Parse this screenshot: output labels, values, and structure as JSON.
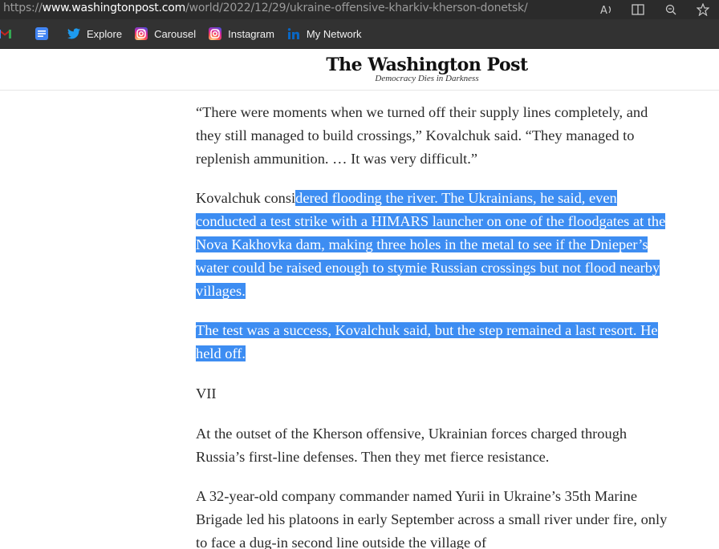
{
  "browser": {
    "url_prefix": "https://",
    "url_host": "www.washingtonpost.com",
    "url_path": "/world/2022/12/29/ukraine-offensive-kharkiv-kherson-donetsk/",
    "icons": [
      "read-aloud-icon",
      "split-screen-icon",
      "zoom-icon",
      "favorite-star-icon"
    ]
  },
  "bookmarks": [
    {
      "icon": "gmail-icon",
      "label": ""
    },
    {
      "icon": "docs-icon",
      "label": ""
    },
    {
      "icon": "twitter-icon",
      "label": "Explore"
    },
    {
      "icon": "instagram-icon",
      "label": "Carousel"
    },
    {
      "icon": "instagram-icon",
      "label": "Instagram"
    },
    {
      "icon": "linkedin-icon",
      "label": "My Network"
    }
  ],
  "header": {
    "title": "The Washington Post",
    "tagline": "Democracy Dies in Darkness"
  },
  "article": {
    "p1": "“There were moments when we turned off their supply lines completely, and they still managed to build crossings,” Kovalchuk said. “They managed to replenish ammunition. … It was very difficult.”",
    "p2_plain": "Kovalchuk consi",
    "p2_selected": "dered flooding the river. The Ukrainians, he said, even conducted a test strike with a HIMARS launcher on one of the floodgates at the Nova Kakhovka dam, making three holes in the metal to see if the Dnieper’s water could be raised enough to stymie Russian crossings but not flood nearby villages.",
    "p3_selected": "The test was a success, Kovalchuk said, but the step remained a last resort. He held off.",
    "section": "VII",
    "p4": "At the outset of the Kherson offensive, Ukrainian forces charged through Russia’s first-line defenses. Then they met fierce resistance.",
    "p5": "A 32-year-old company commander named Yurii in Ukraine’s 35th Marine Brigade led his platoons in early September across a small river under fire, only to face a dug-in second line outside the village of"
  },
  "colors": {
    "selection": "#3d8df2",
    "chrome_dark": "#2b2b2b",
    "bookmarks_bar": "#323232"
  }
}
